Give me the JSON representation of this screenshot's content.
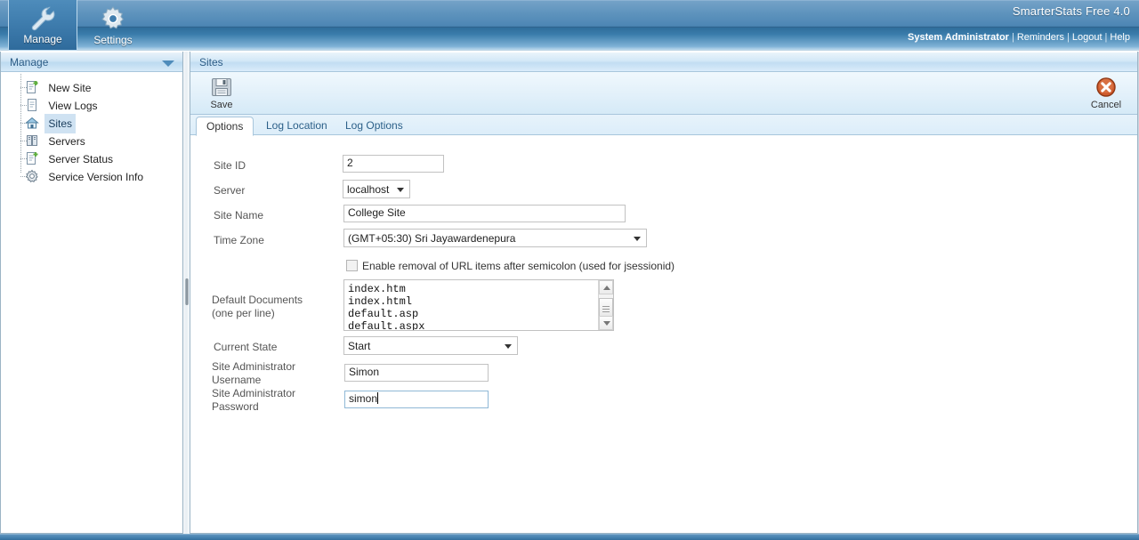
{
  "header": {
    "app_title": "SmarterStats Free 4.0",
    "user": "System Administrator",
    "links": [
      "Reminders",
      "Logout",
      "Help"
    ],
    "separator": "|",
    "module_tabs": [
      {
        "label": "Manage",
        "icon": "wrench-icon",
        "active": true
      },
      {
        "label": "Settings",
        "icon": "gear-icon",
        "active": false
      }
    ]
  },
  "sidebar": {
    "panel_title": "Manage",
    "collapse_icon": "chevron-down-icon",
    "items": [
      {
        "label": "New Site",
        "icon": "new-document-icon",
        "selected": false
      },
      {
        "label": "View Logs",
        "icon": "document-icon",
        "selected": false
      },
      {
        "label": "Sites",
        "icon": "home-icon",
        "selected": true
      },
      {
        "label": "Servers",
        "icon": "servers-icon",
        "selected": false
      },
      {
        "label": "Server Status",
        "icon": "new-document-icon",
        "selected": false
      },
      {
        "label": "Service Version Info",
        "icon": "gear-icon",
        "selected": false
      }
    ]
  },
  "content": {
    "breadcrumb": "Sites",
    "toolbar": {
      "save_label": "Save",
      "save_icon": "floppy-disk-icon",
      "cancel_label": "Cancel",
      "cancel_icon": "cancel-circle-icon"
    },
    "tabs": [
      {
        "label": "Options",
        "active": true
      },
      {
        "label": "Log Location",
        "active": false
      },
      {
        "label": "Log Options",
        "active": false
      }
    ],
    "form": {
      "site_id": {
        "label": "Site ID",
        "value": "2"
      },
      "server": {
        "label": "Server",
        "value": "localhost"
      },
      "site_name": {
        "label": "Site Name",
        "value": "College Site"
      },
      "time_zone": {
        "label": "Time Zone",
        "value": "(GMT+05:30) Sri Jayawardenepura"
      },
      "semicolon_removal": {
        "label": "Enable removal of URL items after semicolon (used for jsessionid)",
        "checked": false
      },
      "default_documents": {
        "label_line1": "Default Documents",
        "label_line2": "(one per line)",
        "value": "index.htm\nindex.html\ndefault.asp\ndefault.aspx"
      },
      "current_state": {
        "label": "Current State",
        "value": "Start"
      },
      "admin_username": {
        "label_line1": "Site Administrator",
        "label_line2": "Username",
        "value": "Simon"
      },
      "admin_password": {
        "label_line1": "Site Administrator",
        "label_line2": "Password",
        "value": "simon",
        "focused": true
      }
    }
  }
}
